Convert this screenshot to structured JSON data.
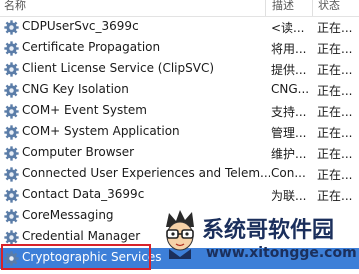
{
  "header": {
    "col_name": "名称",
    "col_description": "描述",
    "col_status": "状态"
  },
  "colors": {
    "selection": "#3d7fd8",
    "highlight_box": "#d8222a",
    "watermark": "#1b2f5c"
  },
  "services": [
    {
      "name": "CDPUserSvc_3699c",
      "description": "<读...",
      "status": "正在...",
      "icon": "gear-icon"
    },
    {
      "name": "Certificate Propagation",
      "description": "将用...",
      "status": "正在...",
      "icon": "gear-icon"
    },
    {
      "name": "Client License Service (ClipSVC)",
      "description": "提供...",
      "status": "正在...",
      "icon": "gear-icon"
    },
    {
      "name": "CNG Key Isolation",
      "description": "CNG...",
      "status": "正在...",
      "icon": "gear-icon"
    },
    {
      "name": "COM+ Event System",
      "description": "支持...",
      "status": "正在...",
      "icon": "gear-icon"
    },
    {
      "name": "COM+ System Application",
      "description": "管理...",
      "status": "正在...",
      "icon": "gear-icon"
    },
    {
      "name": "Computer Browser",
      "description": "维护...",
      "status": "正在...",
      "icon": "gear-icon"
    },
    {
      "name": "Connected User Experiences and Telem...",
      "description": "Con...",
      "status": "正在...",
      "icon": "gear-icon"
    },
    {
      "name": "Contact Data_3699c",
      "description": "为联...",
      "status": "正在...",
      "icon": "gear-icon"
    },
    {
      "name": "CoreMessaging",
      "description": "",
      "status": "",
      "icon": "gear-icon"
    },
    {
      "name": "Credential Manager",
      "description": "",
      "status": "",
      "icon": "gear-icon"
    },
    {
      "name": "Cryptographic Services",
      "description": "",
      "status": "",
      "icon": "gear-icon",
      "selected": true
    }
  ],
  "watermark": {
    "title": "系统哥软件园",
    "url": "www.xitongge.com",
    "icon": "mascot-logo"
  }
}
